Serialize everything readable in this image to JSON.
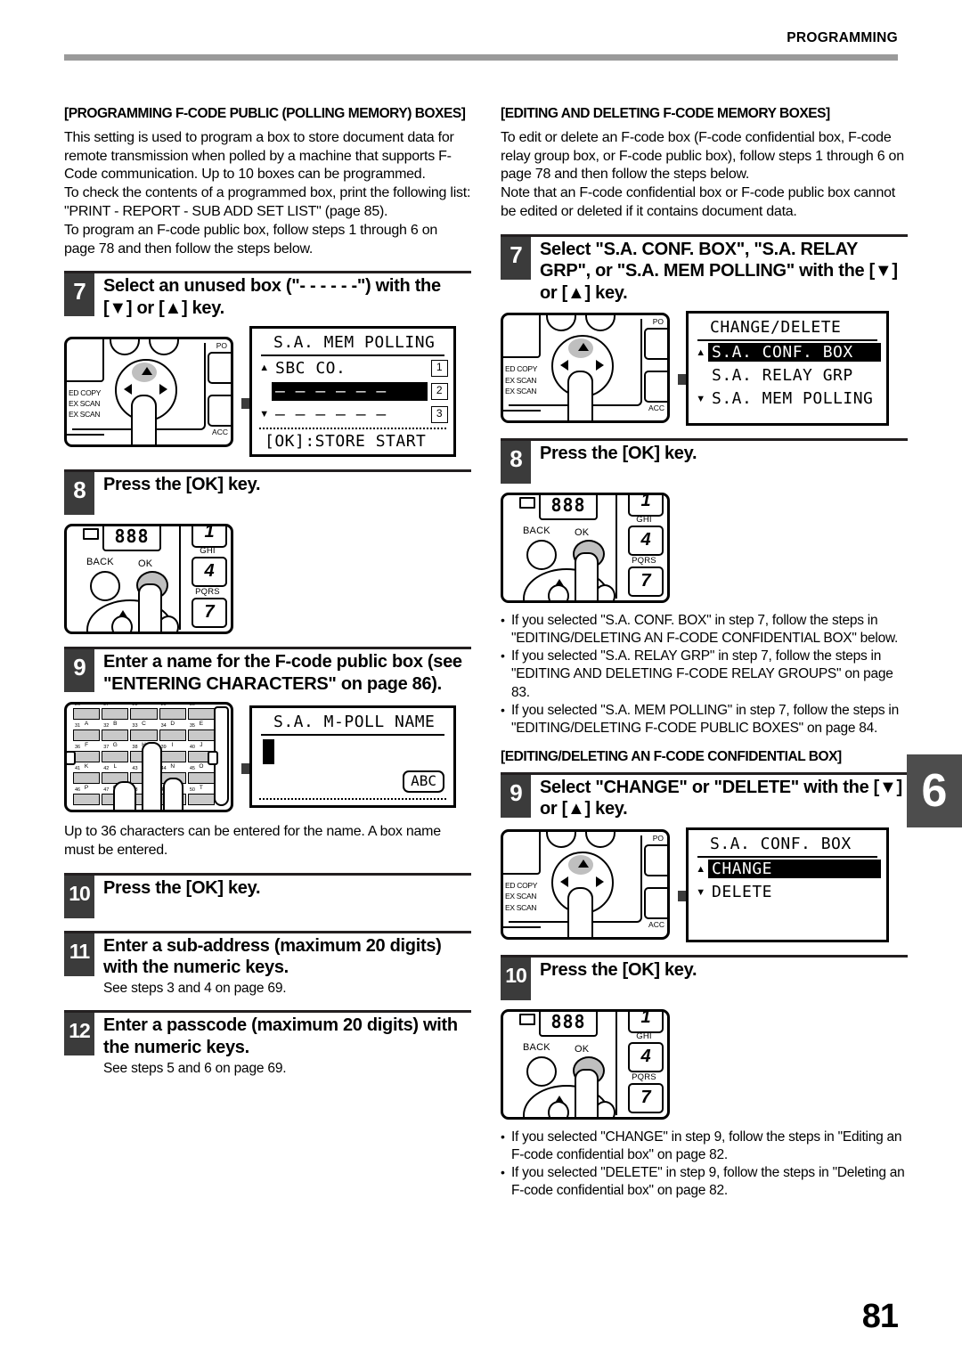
{
  "header": {
    "running_head": "PROGRAMMING"
  },
  "page_number": "81",
  "chapter_tab": "6",
  "left_column": {
    "section_title": "[PROGRAMMING F-CODE PUBLIC (POLLING MEMORY) BOXES]",
    "intro_paragraphs": [
      "This setting is used to program a box to store document data for remote transmission when polled by a machine that supports F-Code communication. Up to 10 boxes can be programmed.",
      "To check the contents of a programmed box, print the following list: \"PRINT - REPORT - SUB ADD SET LIST\" (page 85).",
      "To program an F-code public box, follow steps 1 through 6 on page 78 and then follow the steps below."
    ],
    "step7": {
      "number": "7",
      "title": "Select an unused box (\"- - - - - -\") with the [▼] or [▲] key.",
      "panel": {
        "label_lines": [
          "ED COPY",
          "EX SCAN",
          "EX SCAN"
        ],
        "corner_label": "ACC",
        "top_right_label": "PO"
      },
      "lcd": {
        "title": "S.A. MEM POLLING",
        "rows": [
          {
            "caret": "▲",
            "text": "SBC CO.",
            "badge": "1",
            "selected": false
          },
          {
            "caret": "",
            "text": "– – – – – –",
            "badge": "2",
            "selected": true
          },
          {
            "caret": "▼",
            "text": "– – – – – –",
            "badge": "3",
            "selected": false
          }
        ],
        "footer": "[OK]:STORE START"
      }
    },
    "step8": {
      "number": "8",
      "title": "Press the [OK] key.",
      "keypad": {
        "display": "888",
        "back_label": "BACK",
        "ok_label": "OK",
        "key1": "1",
        "key4": "4",
        "key7": "7",
        "label4": "GHI",
        "label7": "PQRS"
      }
    },
    "step9": {
      "number": "9",
      "title": "Enter a name for the F-code public box (see \"ENTERING CHARACTERS\" on page 86).",
      "keyboard": {
        "row1_nums": [
          "26",
          "27",
          "28",
          "29",
          "30"
        ],
        "row1_letters": [
          "A",
          "B",
          "C",
          "D",
          "E"
        ],
        "row2_nums": [
          "31",
          "32",
          "33",
          "34",
          "35"
        ],
        "row2_letters": [
          "F",
          "G",
          "H",
          "I",
          "J"
        ],
        "row3_nums": [
          "36",
          "37",
          "38",
          "39",
          "40"
        ],
        "row3_letters": [
          "K",
          "L",
          "M",
          "N",
          "O"
        ],
        "row4_nums": [
          "41",
          "42",
          "43",
          "44",
          "45"
        ],
        "row4_letters": [
          "P",
          "Q",
          "R",
          "S",
          "T"
        ],
        "row5_nums": [
          "46",
          "47",
          "48",
          "49",
          "50"
        ]
      },
      "lcd": {
        "title": "S.A. M-POLL NAME",
        "mode_button": "ABC"
      }
    },
    "after_step9_note": "Up to 36 characters can be entered for the name. A box name must be entered.",
    "step10": {
      "number": "10",
      "title": "Press the [OK] key."
    },
    "step11": {
      "number": "11",
      "title": "Enter a sub-address (maximum 20 digits) with the numeric keys.",
      "note": "See steps 3 and 4 on page 69."
    },
    "step12": {
      "number": "12",
      "title": "Enter a passcode (maximum 20 digits) with the numeric keys.",
      "note": "See steps 5 and 6 on page 69."
    }
  },
  "right_column": {
    "section_title": "[EDITING AND DELETING F-CODE MEMORY BOXES]",
    "intro_paragraphs": [
      "To edit or delete an F-code box (F-code confidential box, F-code relay group box, or F-code public box), follow steps 1 through 6 on page 78 and then follow the steps below.",
      "Note that an F-code confidential box or F-code public box cannot be edited or deleted if it contains document data."
    ],
    "step7": {
      "number": "7",
      "title": "Select \"S.A. CONF. BOX\", \"S.A. RELAY GRP\", or \"S.A. MEM POLLING\" with the [▼] or [▲] key.",
      "panel": {
        "label_lines": [
          "ED COPY",
          "EX SCAN",
          "EX SCAN"
        ],
        "corner_label": "ACC",
        "top_right_label": "PO"
      },
      "lcd": {
        "title": "CHANGE/DELETE",
        "rows": [
          {
            "caret": "▲",
            "text": "S.A. CONF. BOX",
            "selected": true
          },
          {
            "caret": "",
            "text": "S.A. RELAY GRP",
            "selected": false
          },
          {
            "caret": "▼",
            "text": "S.A. MEM POLLING",
            "selected": false
          }
        ]
      }
    },
    "step8": {
      "number": "8",
      "title": "Press the [OK] key.",
      "keypad": {
        "display": "888",
        "back_label": "BACK",
        "ok_label": "OK",
        "key1": "1",
        "key4": "4",
        "key7": "7",
        "label4": "GHI",
        "label7": "PQRS"
      }
    },
    "bullets_after_step8": [
      "If you selected \"S.A. CONF. BOX\" in step 7, follow the steps in \"EDITING/DELETING AN F-CODE CONFIDENTIAL BOX\" below.",
      "If you selected \"S.A. RELAY GRP\" in step 7, follow the steps in \"EDITING AND DELETING F-CODE RELAY GROUPS\" on page 83.",
      "If you selected \"S.A. MEM POLLING\" in step 7, follow the steps in \"EDITING/DELETING F-CODE PUBLIC BOXES\" on page 84."
    ],
    "subsection_title": "[EDITING/DELETING AN F-CODE CONFIDENTIAL BOX]",
    "step9": {
      "number": "9",
      "title": "Select \"CHANGE\" or \"DELETE\" with the [▼] or [▲] key.",
      "panel": {
        "label_lines": [
          "ED COPY",
          "EX SCAN",
          "EX SCAN"
        ],
        "corner_label": "ACC",
        "top_right_label": "PO"
      },
      "lcd": {
        "title": "S.A. CONF. BOX",
        "rows": [
          {
            "caret": "▲",
            "text": "CHANGE",
            "selected": true
          },
          {
            "caret": "▼",
            "text": "DELETE",
            "selected": false
          }
        ]
      }
    },
    "step10": {
      "number": "10",
      "title": "Press the [OK] key.",
      "keypad": {
        "display": "888",
        "back_label": "BACK",
        "ok_label": "OK",
        "key1": "1",
        "key4": "4",
        "key7": "7",
        "label4": "GHI",
        "label7": "PQRS"
      }
    },
    "bullets_after_step10": [
      "If you selected \"CHANGE\" in step 9, follow the steps in \"Editing an F-code confidential box\" on page 82.",
      "If you selected \"DELETE\" in step 9, follow the steps in \"Deleting an F-code confidential box\" on page 82."
    ]
  }
}
